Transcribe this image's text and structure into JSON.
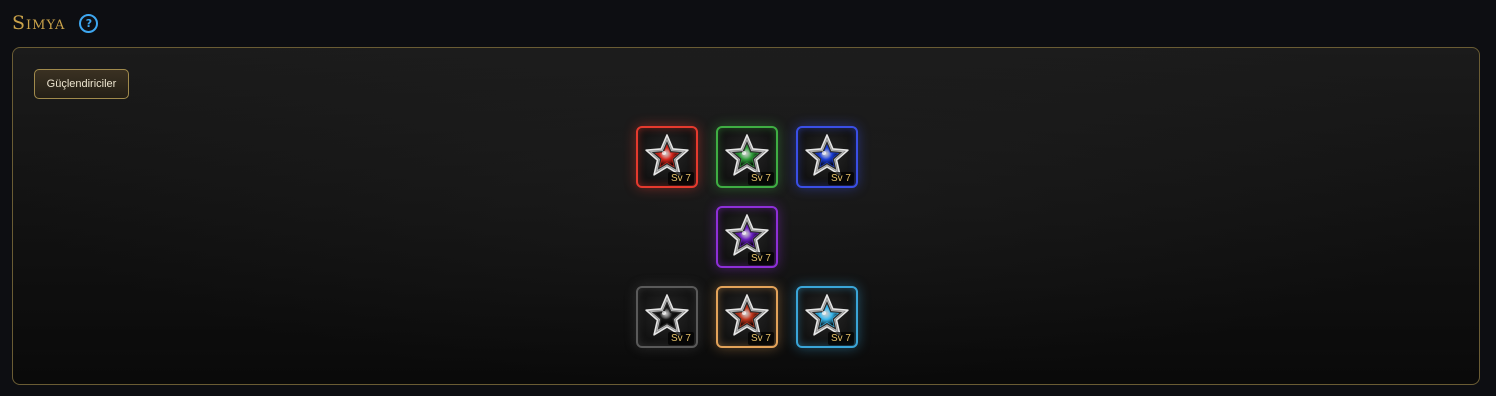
{
  "header": {
    "title": "Sımya",
    "help_icon": "question-circle-icon",
    "help_glyph": "?"
  },
  "tabs": [
    {
      "label": "Güçlendiriciler",
      "active": true
    }
  ],
  "colors": {
    "title": "#c9a24a",
    "help": "#3ea7f0",
    "panel_border": "#6a5c34",
    "level_text": "#e8c36a"
  },
  "stones": [
    {
      "id": "red",
      "label": "Sv 7",
      "icon": "red-star-stone-icon",
      "border": "#e53a2e",
      "gem": "#d8261c",
      "glow": "rgba(229,58,46,0.45)"
    },
    {
      "id": "green",
      "label": "Sv 7",
      "icon": "green-star-stone-icon",
      "border": "#3fae43",
      "gem": "#2f9e3a",
      "glow": "rgba(63,174,67,0.4)"
    },
    {
      "id": "blue",
      "label": "Sv 7",
      "icon": "blue-star-stone-icon",
      "border": "#3a4fe6",
      "gem": "#1b3ed8",
      "glow": "rgba(58,79,230,0.45)"
    },
    {
      "id": "purple",
      "label": "Sv 7",
      "icon": "purple-star-stone-icon",
      "border": "#8e2fd8",
      "gem": "#6b1fc2",
      "glow": "rgba(142,47,216,0.45)"
    },
    {
      "id": "black",
      "label": "Sv 7",
      "icon": "black-star-stone-icon",
      "border": "#5a5a5a",
      "gem": "#151515",
      "glow": "rgba(110,110,110,0.3)"
    },
    {
      "id": "orange",
      "label": "Sv 7",
      "icon": "orange-star-stone-icon",
      "border": "#e3a35a",
      "gem": "#c2361c",
      "glow": "rgba(227,163,90,0.4)"
    },
    {
      "id": "cyan",
      "label": "Sv 7",
      "icon": "cyan-star-stone-icon",
      "border": "#3aa5d8",
      "gem": "#38b8ee",
      "glow": "rgba(58,165,216,0.45)"
    }
  ]
}
